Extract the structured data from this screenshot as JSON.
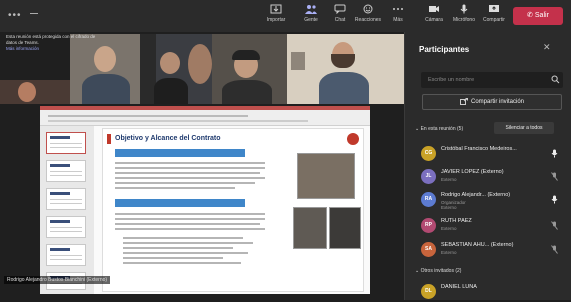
{
  "topbar": {
    "timer": "",
    "tools": [
      {
        "id": "import",
        "label": "Importar"
      },
      {
        "id": "people",
        "label": "Gente"
      },
      {
        "id": "chat",
        "label": "Chat"
      },
      {
        "id": "reactions",
        "label": "Reacciones"
      },
      {
        "id": "more",
        "label": "Más"
      },
      {
        "id": "camera",
        "label": "Cámara"
      },
      {
        "id": "mic",
        "label": "Micrófono"
      },
      {
        "id": "share",
        "label": "Compartir"
      }
    ],
    "leave_label": "Salir"
  },
  "privacy_notice": {
    "text": "Esta reunión está protegida con el cifrado de datos de Teams.",
    "link": "Más información"
  },
  "slide": {
    "title": "Objetivo y Alcance del Contrato"
  },
  "presenter_caption": "Rodrigo Alejandro Bustos Bianchini (Externo)",
  "participants_panel": {
    "title": "Participantes",
    "search_placeholder": "Escribe un nombre",
    "share_invite_label": "Compartir invitación",
    "in_meeting_label": "En esta reunión (5)",
    "mute_all_label": "Silenciar a todos",
    "others_label": "Otros invitados (2)",
    "people": [
      {
        "initials": "CG",
        "name": "Cristóbal Francisco Medeiros...",
        "role": "",
        "color": "#c9a227"
      },
      {
        "initials": "JL",
        "name": "JAVIER LOPEZ (Externo)",
        "role": "Externo",
        "color": "#7b6fbf"
      },
      {
        "initials": "RA",
        "name": "Rodrigo Alejandr... (Externo)",
        "role": "Organizador",
        "role2": "Externo",
        "color": "#5c7bd1"
      },
      {
        "initials": "RP",
        "name": "RUTH PAEZ",
        "role": "Externo",
        "color": "#b24a72"
      },
      {
        "initials": "SA",
        "name": "SEBASTIAN AHU... (Externo)",
        "role": "Externo",
        "color": "#c7643c"
      },
      {
        "initials": "DL",
        "name": "DANIEL LUNA",
        "role": "",
        "color": "#c9a227"
      }
    ]
  },
  "colors": {
    "leave": "#c4314b",
    "panel_bg": "#2b2b2b",
    "slide_title": "#1f3a6e",
    "accent_blue": "#3f86c9"
  }
}
